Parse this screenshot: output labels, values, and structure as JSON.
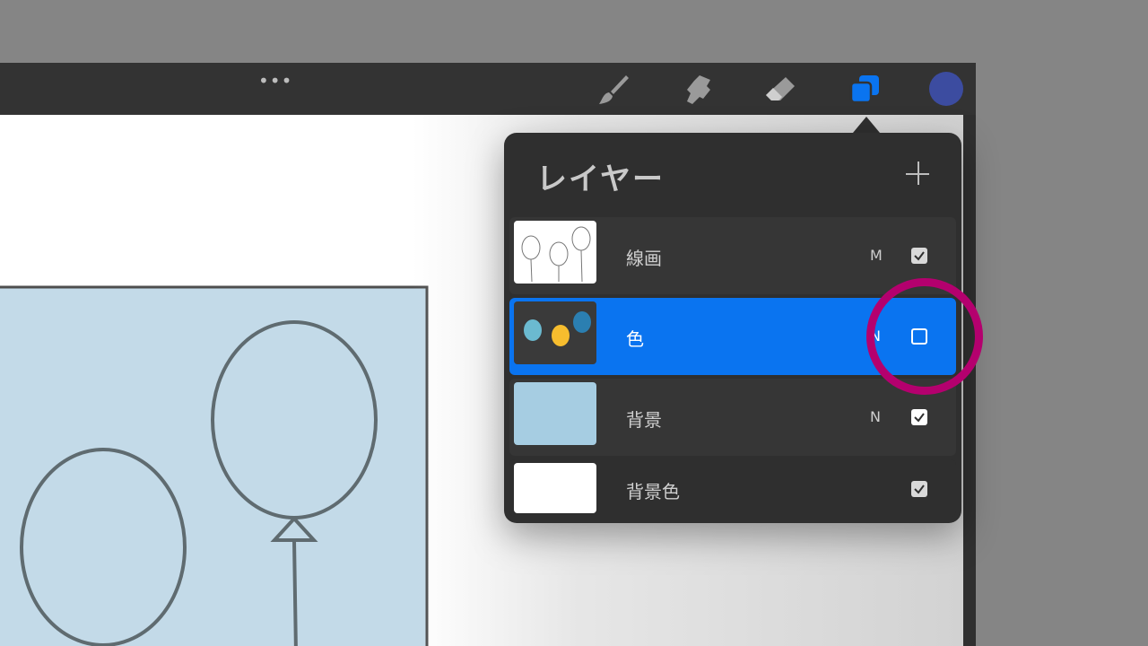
{
  "toolbar": {
    "more": "•••",
    "tools": [
      {
        "icon": "brush-icon"
      },
      {
        "icon": "smudge-icon"
      },
      {
        "icon": "eraser-icon"
      },
      {
        "icon": "layers-icon",
        "active": true
      }
    ],
    "color": "#3c4ca0",
    "accent": "#0a74f0"
  },
  "layers_panel": {
    "title": "レイヤー",
    "add": "+",
    "layers": [
      {
        "name": "線画",
        "blend": "M",
        "visible": true
      },
      {
        "name": "色",
        "blend": "N",
        "visible": false,
        "selected": true
      },
      {
        "name": "背景",
        "blend": "N",
        "visible": true
      },
      {
        "name": "背景色",
        "blend": "",
        "visible": true
      }
    ]
  },
  "annotation": {
    "color": "#b4006e"
  }
}
